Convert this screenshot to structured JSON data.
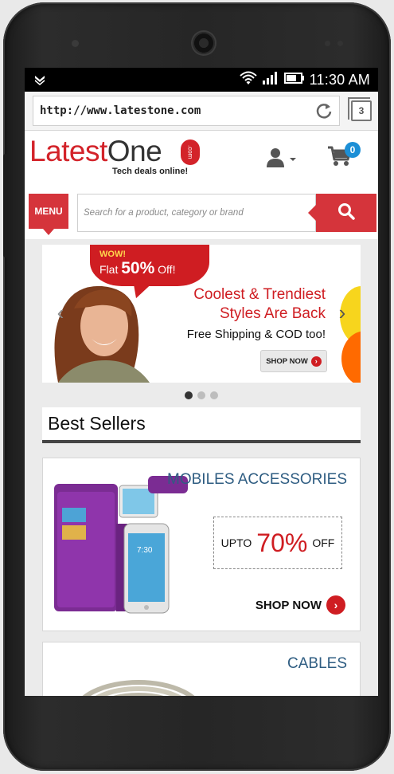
{
  "status_bar": {
    "time": "11:30 AM"
  },
  "browser": {
    "url": "http://www.latestone.com",
    "tab_count": "3"
  },
  "site": {
    "logo_text_main": "Latest",
    "logo_text_accent": "One",
    "logo_com": ".com",
    "tagline": "Tech deals online!",
    "cart_count": "0",
    "menu_label": "MENU",
    "search_placeholder": "Search for a product, category or brand"
  },
  "banner": {
    "wow": "WOW!",
    "flat_prefix": "Flat ",
    "flat_value": "50%",
    "flat_suffix": " Off!",
    "title_line1": "Coolest & Trendiest",
    "title_line2": "Styles Are Back",
    "subtitle": "Free Shipping & COD too!",
    "cta": "SHOP NOW",
    "slide_count": 3,
    "active_slide": 1
  },
  "best_sellers": {
    "title": "Best Sellers"
  },
  "cards": [
    {
      "title": "MOBILES ACCESSORIES",
      "offer_upto": "UPTO",
      "offer_pct": "70%",
      "offer_off": "OFF",
      "cta": "SHOP NOW"
    },
    {
      "title": "CABLES"
    }
  ],
  "colors": {
    "brand_red": "#d5343b",
    "accent_blue": "#1c8fd6",
    "card_title_blue": "#2f5d82"
  }
}
